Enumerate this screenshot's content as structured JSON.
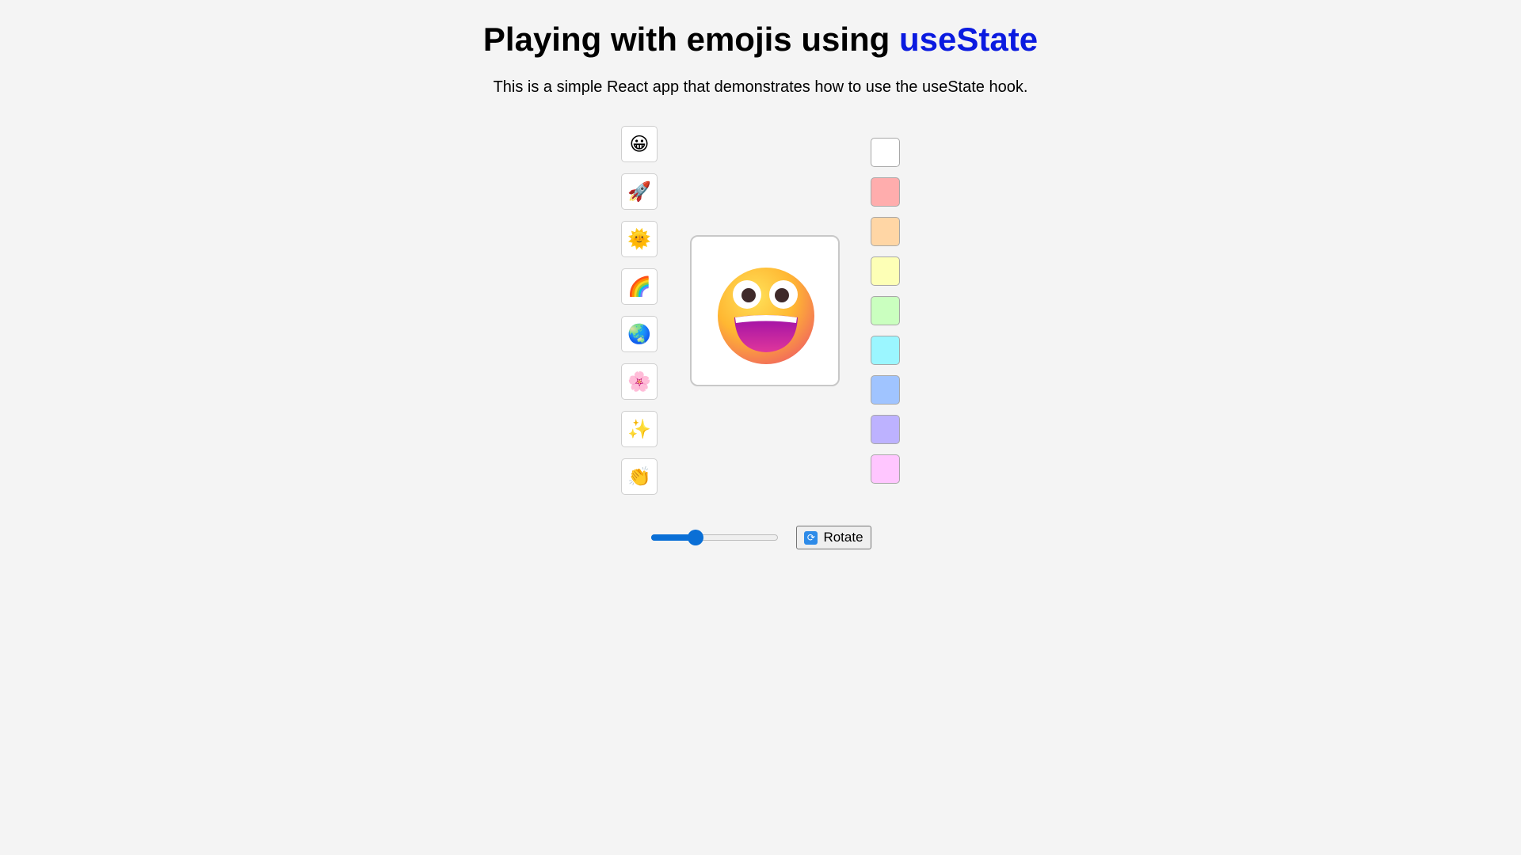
{
  "header": {
    "title_prefix": "Playing with emojis using ",
    "title_accent": "useState",
    "subtitle": "This is a simple React app that demonstrates how to use the useState hook."
  },
  "emoji_picker": {
    "items": [
      {
        "emoji": "😀",
        "icon": "grinning-face-icon"
      },
      {
        "emoji": "🚀",
        "icon": "rocket-icon"
      },
      {
        "emoji": "🌞",
        "icon": "sun-with-face-icon"
      },
      {
        "emoji": "🌈",
        "icon": "rainbow-icon"
      },
      {
        "emoji": "🌏",
        "icon": "globe-icon"
      },
      {
        "emoji": "🌸",
        "icon": "cherry-blossom-icon"
      },
      {
        "emoji": "✨",
        "icon": "sparkles-icon"
      },
      {
        "emoji": "👏",
        "icon": "clapping-hands-icon"
      }
    ]
  },
  "display": {
    "selected_icon": "grinning-face-icon",
    "background": "#ffffff"
  },
  "colors": [
    "#ffffff",
    "#ffadad",
    "#ffd6a5",
    "#fdffb6",
    "#caffbf",
    "#9bf6ff",
    "#a0c4ff",
    "#bdb2ff",
    "#ffc6ff"
  ],
  "controls": {
    "slider_fraction": 0.35,
    "rotate_label": "Rotate",
    "rotate_icon": "rotate-arrows-icon"
  },
  "accent_color": "#0a1ae0"
}
